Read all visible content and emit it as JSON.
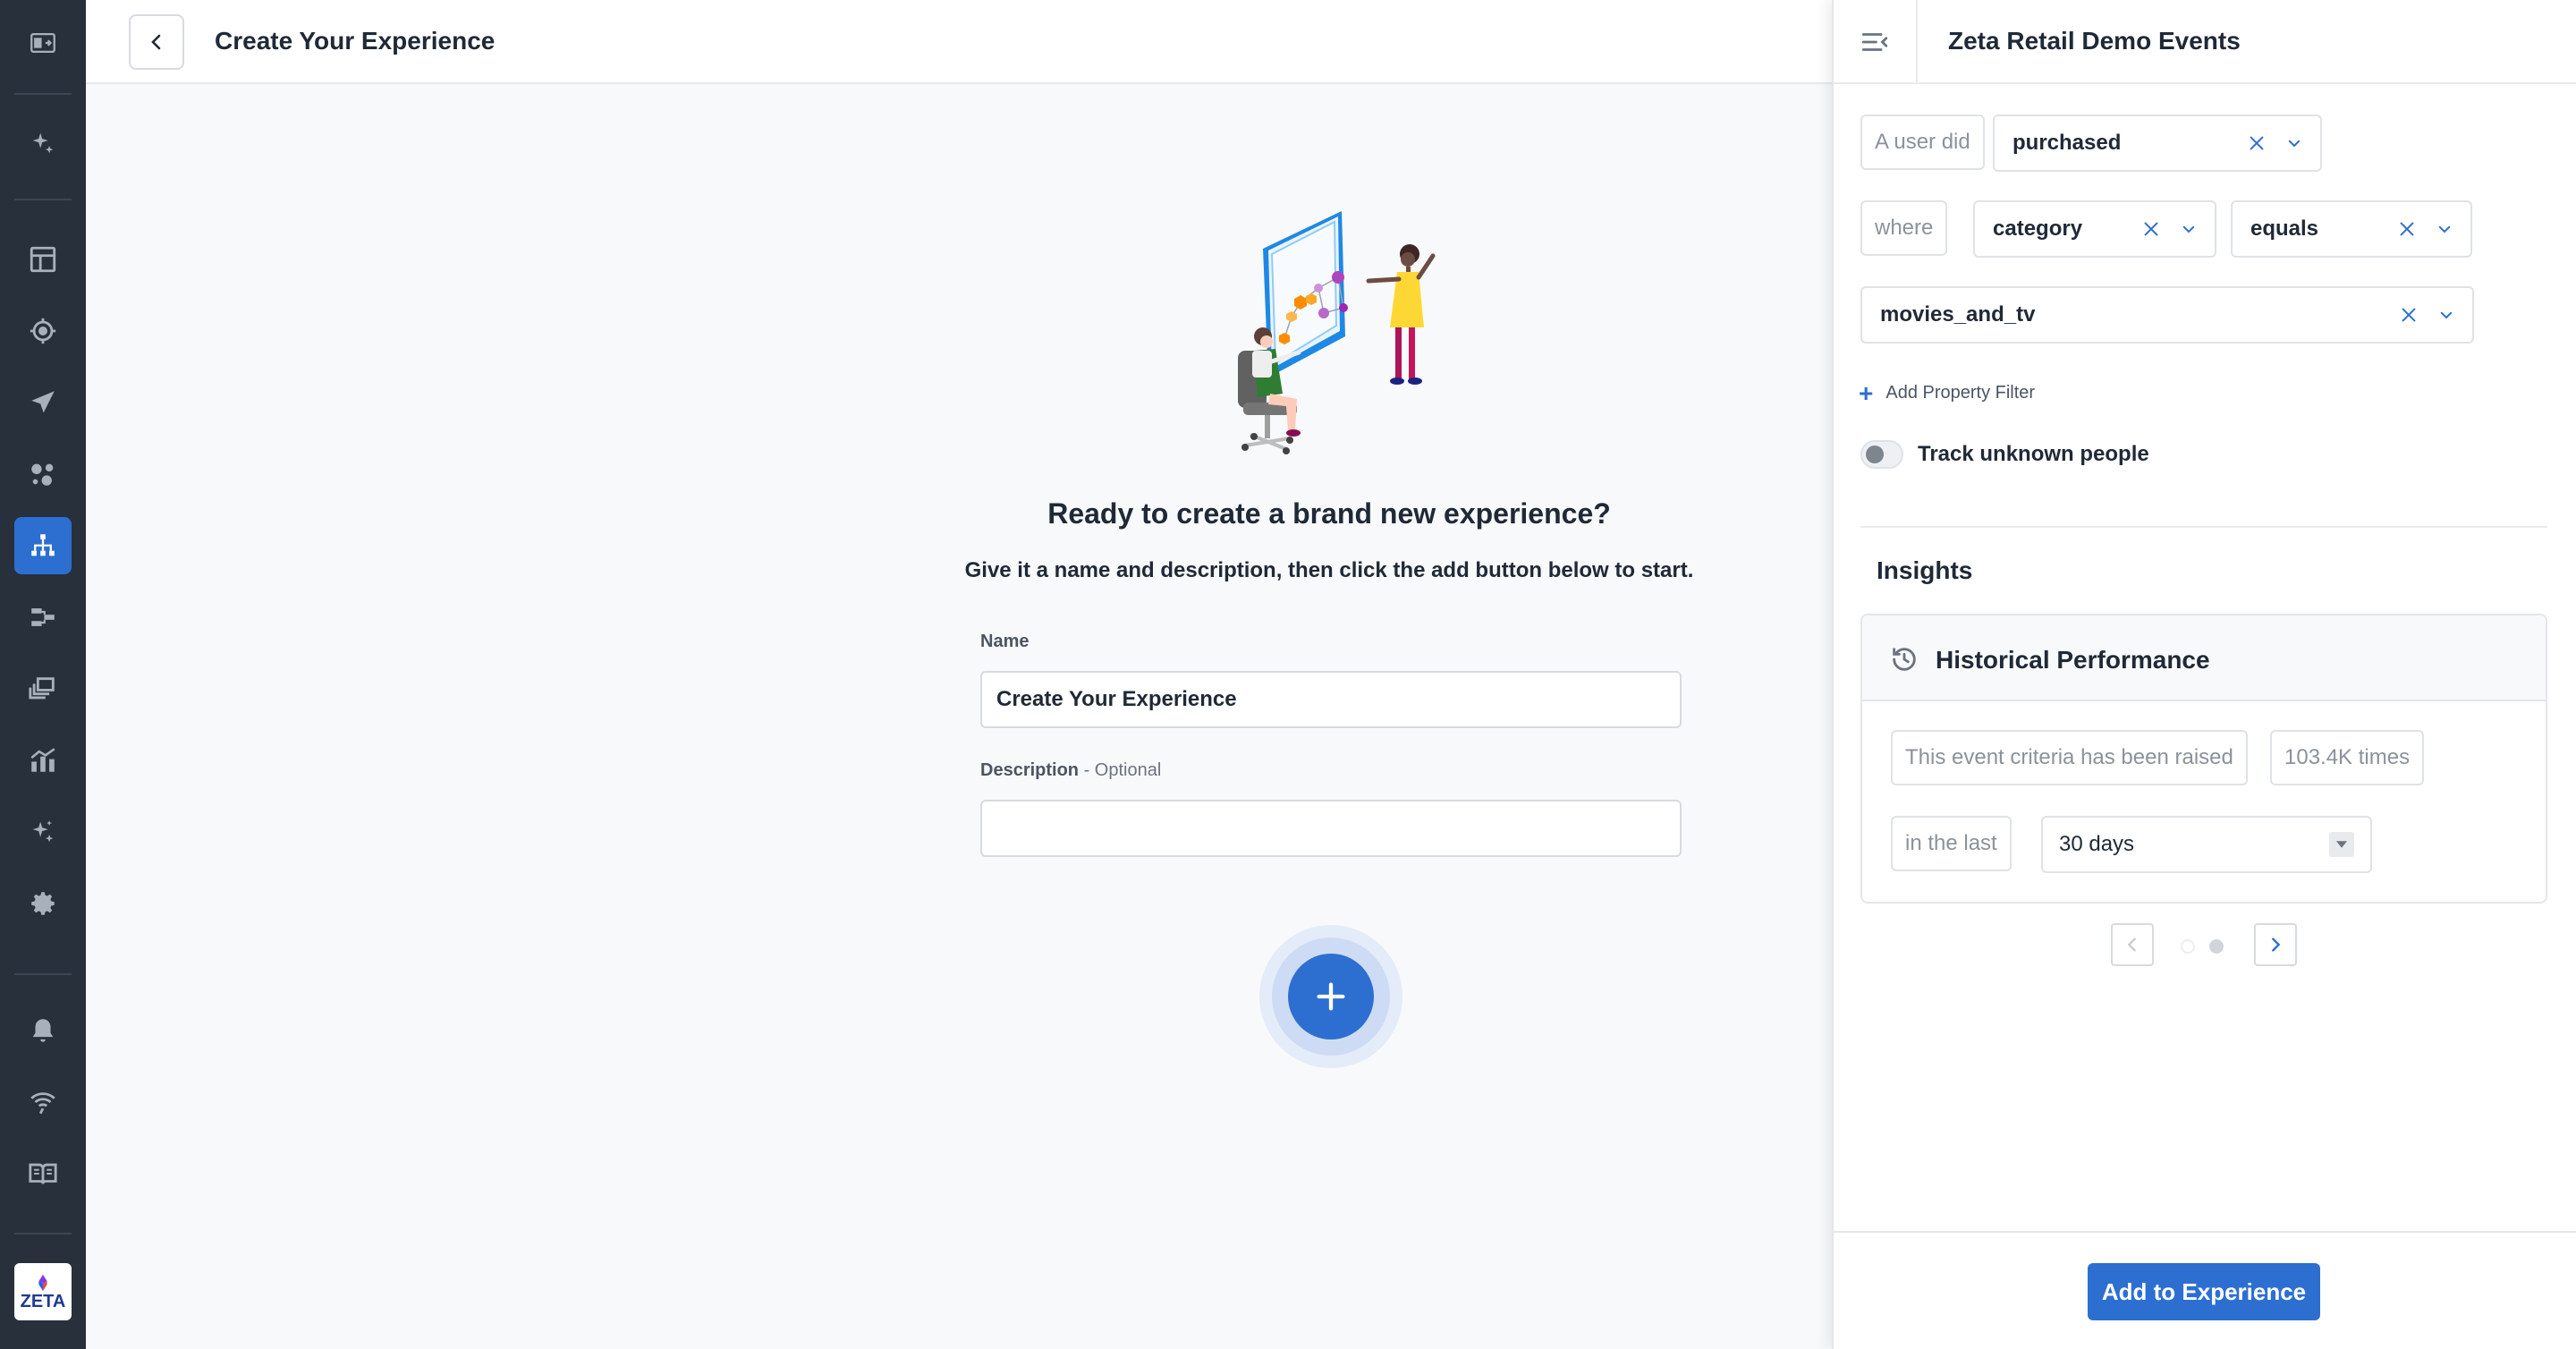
{
  "header": {
    "back_label": "Back",
    "title": "Create Your Experience"
  },
  "sidebar": {
    "items": [
      {
        "icon": "collapse-nav-icon"
      },
      {
        "icon": "sparkle-icon"
      },
      {
        "icon": "dashboard-icon"
      },
      {
        "icon": "target-icon"
      },
      {
        "icon": "send-icon"
      },
      {
        "icon": "segments-icon"
      },
      {
        "icon": "hierarchy-icon",
        "active": true
      },
      {
        "icon": "flow-icon"
      },
      {
        "icon": "content-stack-icon"
      },
      {
        "icon": "analytics-icon"
      },
      {
        "icon": "ai-sparkle-icon"
      },
      {
        "icon": "gear-icon"
      },
      {
        "icon": "bell-icon"
      },
      {
        "icon": "broadcast-icon"
      },
      {
        "icon": "book-icon"
      }
    ],
    "logo_text": "ZETA"
  },
  "main": {
    "headline": "Ready to create a brand new experience?",
    "subline": "Give it a name and description, then click the add button below to start.",
    "name_label": "Name",
    "name_value": "Create Your Experience",
    "description_label": "Description",
    "description_optional": " - Optional",
    "description_value": ""
  },
  "panel": {
    "title": "Zeta Retail Demo Events",
    "row1": {
      "prefix": "A user did",
      "event": "purchased"
    },
    "row2": {
      "prefix": "where",
      "property": "category",
      "operator": "equals"
    },
    "row3": {
      "value": "movies_and_tv"
    },
    "add_filter": "Add Property Filter",
    "toggle_label": "Track unknown people",
    "toggle_on": false,
    "insights_title": "Insights",
    "card": {
      "title": "Historical Performance",
      "sentence_1": "This event criteria has been raised",
      "count": "103.4K times",
      "sentence_2": "in the last",
      "period": "30 days"
    },
    "pager": {
      "current": 2,
      "total": 2
    },
    "cta": "Add to Experience"
  },
  "colors": {
    "accent": "#2d6fd0",
    "sidebar_bg": "#27303b",
    "border": "#dfe2e6"
  }
}
